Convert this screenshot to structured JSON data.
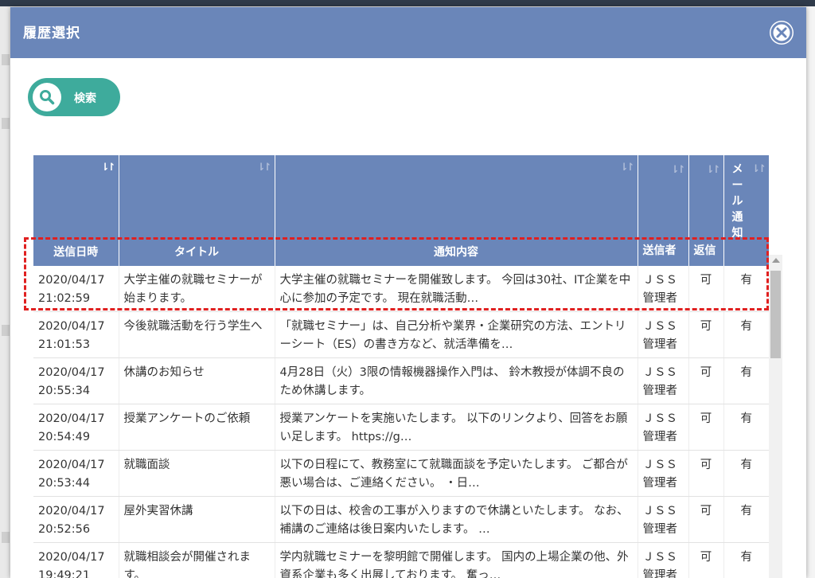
{
  "modal": {
    "title": "履歴選択",
    "search_label": "検索"
  },
  "table": {
    "headers": {
      "sent_at": "送信日時",
      "title": "タイトル",
      "content": "通知内容",
      "sender": "送信者",
      "reply": "返信",
      "mail": "メール通知"
    },
    "rows": [
      {
        "date": "2020/04/17",
        "time": "21:02:59",
        "title": "大学主催の就職セミナーが始まります。",
        "content": "大学主催の就職セミナーを開催致します。 今回は30社、IT企業を中心に参加の予定です。 現在就職活動…",
        "sender_a": "ＪＳＳ",
        "sender_b": "管理者",
        "reply": "可",
        "mail": "有"
      },
      {
        "date": "2020/04/17",
        "time": "21:01:53",
        "title": "今後就職活動を行う学生へ",
        "content": "「就職セミナー」は、自己分析や業界・企業研究の方法、エントリーシート（ES）の書き方など、就活準備を…",
        "sender_a": "ＪＳＳ",
        "sender_b": "管理者",
        "reply": "可",
        "mail": "有"
      },
      {
        "date": "2020/04/17",
        "time": "20:55:34",
        "title": "休講のお知らせ",
        "content": "4月28日（火）3限の情報機器操作入門は、 鈴木教授が体調不良のため休講します。",
        "sender_a": "ＪＳＳ",
        "sender_b": "管理者",
        "reply": "可",
        "mail": "有"
      },
      {
        "date": "2020/04/17",
        "time": "20:54:49",
        "title": "授業アンケートのご依頼",
        "content": "授業アンケートを実施いたします。 以下のリンクより、回答をお願い足します。 https://g…",
        "sender_a": "ＪＳＳ",
        "sender_b": "管理者",
        "reply": "可",
        "mail": "有"
      },
      {
        "date": "2020/04/17",
        "time": "20:53:44",
        "title": "就職面談",
        "content": "以下の日程にて、教務室にて就職面談を予定いたします。 ご都合が悪い場合は、ご連絡ください。 ・日…",
        "sender_a": "ＪＳＳ",
        "sender_b": "管理者",
        "reply": "可",
        "mail": "有"
      },
      {
        "date": "2020/04/17",
        "time": "20:52:56",
        "title": "屋外実習休講",
        "content": "以下の日は、校舎の工事が入りますので休講といたします。 なお、補講のご連絡は後日案内いたします。 …",
        "sender_a": "ＪＳＳ",
        "sender_b": "管理者",
        "reply": "可",
        "mail": "有"
      },
      {
        "date": "2020/04/17",
        "time": "19:49:21",
        "title": "就職相談会が開催されます。",
        "content": "学内就職セミナーを黎明館で開催します。 国内の上場企業の他、外資系企業も多く出展しております。 奮っ…",
        "sender_a": "ＪＳＳ",
        "sender_b": "管理者",
        "reply": "可",
        "mail": "有"
      }
    ]
  },
  "icons": {
    "close": "close-circle-icon",
    "search": "magnifier-icon",
    "sort": "sort-arrows-icon"
  },
  "colors": {
    "header": "#6a86b9",
    "search_button": "#3eab9c",
    "highlight": "#e02020"
  }
}
